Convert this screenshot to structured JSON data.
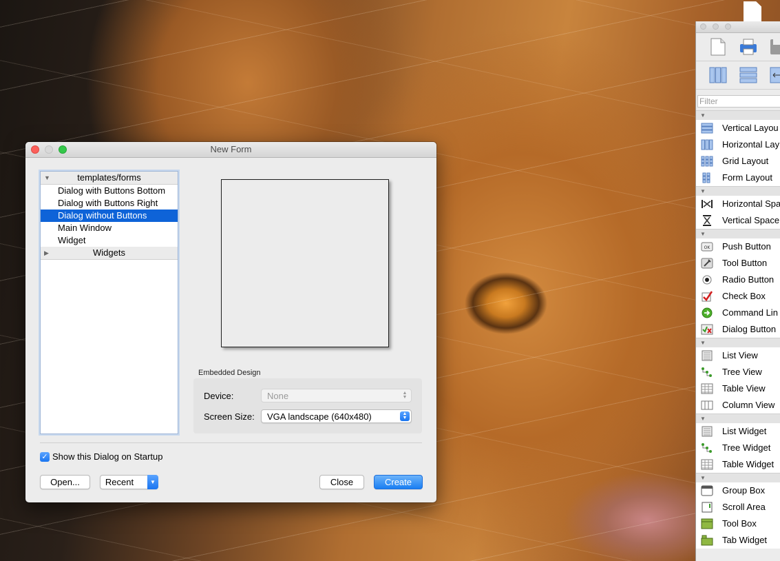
{
  "dialog": {
    "title": "New Form",
    "tree": {
      "templates_header": "templates/forms",
      "items": [
        {
          "label": "Dialog with Buttons Bottom",
          "selected": false
        },
        {
          "label": "Dialog with Buttons Right",
          "selected": false
        },
        {
          "label": "Dialog without Buttons",
          "selected": true
        },
        {
          "label": "Main Window",
          "selected": false
        },
        {
          "label": "Widget",
          "selected": false
        }
      ],
      "widgets_header": "Widgets"
    },
    "embedded": {
      "group_label": "Embedded Design",
      "device_label": "Device:",
      "device_value": "None",
      "screen_size_label": "Screen Size:",
      "screen_size_value": "VGA landscape (640x480)"
    },
    "show_on_startup": {
      "label": "Show this Dialog on Startup",
      "checked": true
    },
    "buttons": {
      "open": "Open...",
      "recent": "Recent",
      "close": "Close",
      "create": "Create"
    }
  },
  "widget_box": {
    "filter_placeholder": "Filter",
    "categories": [
      {
        "items": [
          {
            "label": "Vertical Layou",
            "icon": "vertical-layout-icon"
          },
          {
            "label": "Horizontal Lay",
            "icon": "horizontal-layout-icon"
          },
          {
            "label": "Grid Layout",
            "icon": "grid-layout-icon"
          },
          {
            "label": "Form Layout",
            "icon": "form-layout-icon"
          }
        ]
      },
      {
        "items": [
          {
            "label": "Horizontal Spa",
            "icon": "horizontal-spacer-icon"
          },
          {
            "label": "Vertical Space",
            "icon": "vertical-spacer-icon"
          }
        ]
      },
      {
        "items": [
          {
            "label": "Push Button",
            "icon": "push-button-icon"
          },
          {
            "label": "Tool Button",
            "icon": "tool-button-icon"
          },
          {
            "label": "Radio Button",
            "icon": "radio-button-icon"
          },
          {
            "label": "Check Box",
            "icon": "check-box-icon"
          },
          {
            "label": "Command Lin",
            "icon": "command-link-icon"
          },
          {
            "label": "Dialog Button",
            "icon": "dialog-button-box-icon"
          }
        ]
      },
      {
        "items": [
          {
            "label": "List View",
            "icon": "list-view-icon"
          },
          {
            "label": "Tree View",
            "icon": "tree-view-icon"
          },
          {
            "label": "Table View",
            "icon": "table-view-icon"
          },
          {
            "label": "Column View",
            "icon": "column-view-icon"
          }
        ]
      },
      {
        "items": [
          {
            "label": "List Widget",
            "icon": "list-widget-icon"
          },
          {
            "label": "Tree Widget",
            "icon": "tree-widget-icon"
          },
          {
            "label": "Table Widget",
            "icon": "table-widget-icon"
          }
        ]
      },
      {
        "items": [
          {
            "label": "Group Box",
            "icon": "group-box-icon"
          },
          {
            "label": "Scroll Area",
            "icon": "scroll-area-icon"
          },
          {
            "label": "Tool Box",
            "icon": "tool-box-icon"
          },
          {
            "label": "Tab Widget",
            "icon": "tab-widget-icon"
          }
        ]
      }
    ]
  },
  "colors": {
    "selection": "#0e63d8",
    "accent_blue": "#1a7ef2"
  }
}
